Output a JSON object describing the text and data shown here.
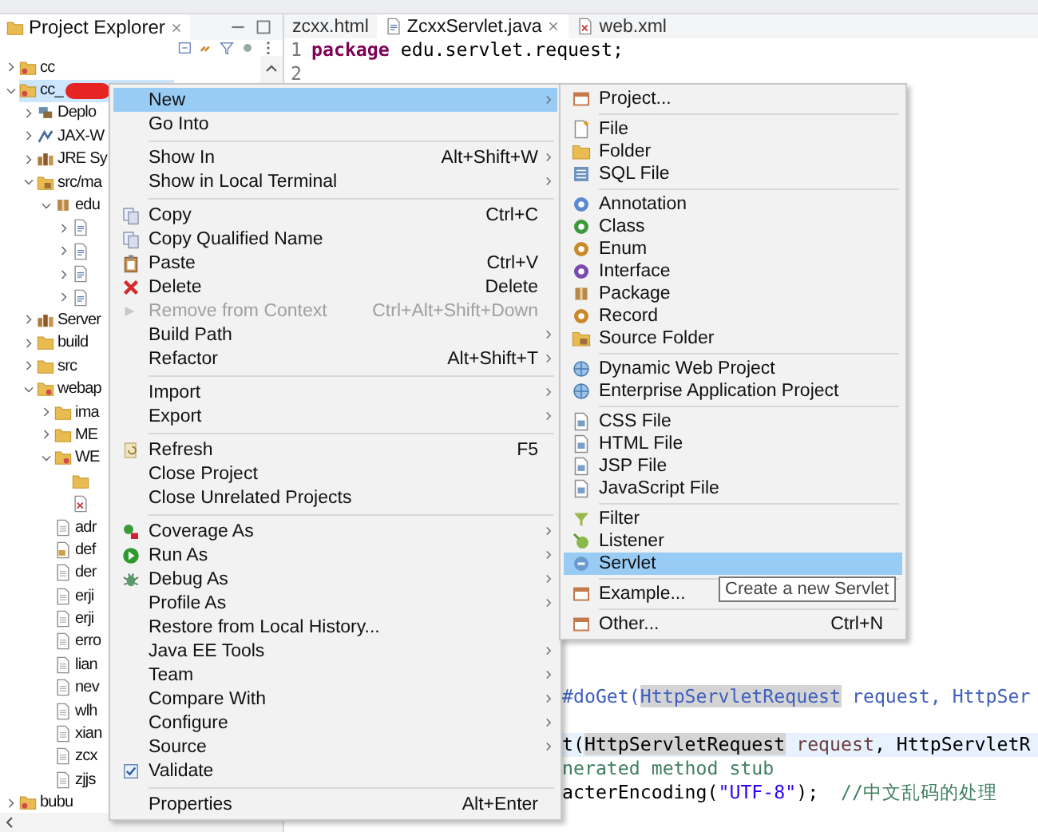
{
  "explorer": {
    "title": "Project Explorer",
    "tree": [
      {
        "label": "cc",
        "kind": "project",
        "expandable": true,
        "expanded": false,
        "selected": false
      },
      {
        "label": "cc_",
        "kind": "project",
        "expandable": true,
        "expanded": true,
        "selected": true,
        "redacted": true,
        "children": [
          {
            "label": "Deplo",
            "kind": "deploy",
            "expandable": true,
            "expanded": false,
            "selected": false
          },
          {
            "label": "JAX-W",
            "kind": "service",
            "expandable": true,
            "expanded": false,
            "selected": false
          },
          {
            "label": "JRE Sy",
            "kind": "library",
            "expandable": true,
            "expanded": false,
            "selected": false
          },
          {
            "label": "src/ma",
            "kind": "src_folder",
            "expandable": true,
            "expanded": true,
            "selected": false,
            "children": [
              {
                "label": "edu",
                "kind": "package",
                "expandable": true,
                "expanded": true,
                "selected": false,
                "children": [
                  {
                    "kind": "java",
                    "expandable": true,
                    "expanded": false,
                    "selected": false
                  },
                  {
                    "kind": "java",
                    "expandable": true,
                    "expanded": false,
                    "selected": false
                  },
                  {
                    "kind": "java",
                    "expandable": true,
                    "expanded": false,
                    "selected": false
                  },
                  {
                    "kind": "java",
                    "expandable": true,
                    "expanded": false,
                    "selected": false
                  }
                ]
              }
            ]
          },
          {
            "label": "Server",
            "kind": "library",
            "expandable": true,
            "expanded": false,
            "selected": false
          },
          {
            "label": "build",
            "kind": "folder",
            "expandable": true,
            "expanded": false,
            "selected": false
          },
          {
            "label": "src",
            "kind": "folder",
            "expandable": true,
            "expanded": false,
            "selected": false
          },
          {
            "label": "webap",
            "kind": "web_folder",
            "expandable": true,
            "expanded": true,
            "selected": false,
            "children": [
              {
                "label": "ima",
                "kind": "folder",
                "expandable": true,
                "expanded": false,
                "selected": false
              },
              {
                "label": "ME",
                "kind": "folder",
                "expandable": true,
                "expanded": false,
                "selected": false
              },
              {
                "label": "WE",
                "kind": "web_folder",
                "expandable": true,
                "expanded": true,
                "selected": false,
                "children": [
                  {
                    "kind": "folder",
                    "expandable": false,
                    "expanded": false,
                    "selected": false
                  },
                  {
                    "kind": "xml",
                    "expandable": false,
                    "expanded": false,
                    "selected": false
                  }
                ]
              },
              {
                "label": "adr",
                "kind": "file",
                "expandable": false,
                "expanded": false,
                "selected": false
              },
              {
                "label": "def",
                "kind": "jsp",
                "expandable": false,
                "expanded": false,
                "selected": false
              },
              {
                "label": "der",
                "kind": "file",
                "expandable": false,
                "expanded": false,
                "selected": false
              },
              {
                "label": "erji",
                "kind": "file",
                "expandable": false,
                "expanded": false,
                "selected": false
              },
              {
                "label": "erji",
                "kind": "file",
                "expandable": false,
                "expanded": false,
                "selected": false
              },
              {
                "label": "erro",
                "kind": "file",
                "expandable": false,
                "expanded": false,
                "selected": false
              },
              {
                "label": "lian",
                "kind": "file",
                "expandable": false,
                "expanded": false,
                "selected": false
              },
              {
                "label": "nev",
                "kind": "file",
                "expandable": false,
                "expanded": false,
                "selected": false
              },
              {
                "label": "wlh",
                "kind": "file",
                "expandable": false,
                "expanded": false,
                "selected": false
              },
              {
                "label": "xian",
                "kind": "file",
                "expandable": false,
                "expanded": false,
                "selected": false
              },
              {
                "label": "zcx",
                "kind": "file",
                "expandable": false,
                "expanded": false,
                "selected": false
              },
              {
                "label": "zjjs",
                "kind": "file",
                "expandable": false,
                "expanded": false,
                "selected": false
              }
            ]
          }
        ]
      },
      {
        "label": "bubu",
        "kind": "project",
        "expandable": true,
        "expanded": false,
        "selected": false
      }
    ]
  },
  "editor": {
    "tabs": [
      {
        "label": "zcxx.html",
        "kind": "plain",
        "selected": false
      },
      {
        "label": "ZcxxServlet.java",
        "kind": "java",
        "selected": true
      },
      {
        "label": "web.xml",
        "kind": "xml",
        "selected": false
      }
    ],
    "lines": [
      {
        "number": "1",
        "segments": [
          {
            "kind": "keyword",
            "text": "package"
          },
          {
            "kind": "plain",
            "text": " edu.servlet.request;"
          }
        ]
      },
      {
        "number": "2"
      }
    ],
    "covered_lines": [
      {
        "kind": "javadoc",
        "current": false,
        "segments": [
          {
            "kind": "javadoc",
            "text": "#doGet("
          },
          {
            "kind": "highlight",
            "text": "HttpServletRequest"
          },
          {
            "kind": "javadoc",
            "text": " request, HttpSer"
          }
        ]
      },
      {
        "kind": "code",
        "current": true,
        "segments": [
          {
            "kind": "plain",
            "text": "t("
          },
          {
            "kind": "highlight",
            "text": "HttpServletRequest"
          },
          {
            "kind": "param",
            "text": " request"
          },
          {
            "kind": "plain",
            "text": ", HttpServletR"
          }
        ]
      },
      {
        "kind": "code",
        "current": false,
        "segments": [
          {
            "kind": "comment",
            "text": "nerated method stub"
          }
        ]
      },
      {
        "kind": "code",
        "current": false,
        "segments": [
          {
            "kind": "plain",
            "text": "acterEncoding("
          },
          {
            "kind": "string",
            "text": "\"UTF-8\""
          },
          {
            "kind": "plain",
            "text": ");  "
          },
          {
            "kind": "comment",
            "text": "//中文乱码的处理"
          }
        ]
      }
    ]
  },
  "context_menu": {
    "items": [
      {
        "kind": "plain",
        "label": "New",
        "selected": true,
        "disabled": false,
        "has_submenu": true
      },
      {
        "kind": "plain",
        "label": "Go Into",
        "selected": false,
        "disabled": false,
        "has_submenu": false
      },
      {
        "kind": "separator"
      },
      {
        "kind": "plain",
        "label": "Show In",
        "shortcut": "Alt+Shift+W",
        "selected": false,
        "disabled": false,
        "has_submenu": true
      },
      {
        "kind": "plain",
        "label": "Show in Local Terminal",
        "selected": false,
        "disabled": false,
        "has_submenu": true
      },
      {
        "kind": "separator"
      },
      {
        "kind": "copy",
        "label": "Copy",
        "shortcut": "Ctrl+C",
        "selected": false,
        "disabled": false,
        "has_submenu": false
      },
      {
        "kind": "copy",
        "label": "Copy Qualified Name",
        "selected": false,
        "disabled": false,
        "has_submenu": false
      },
      {
        "kind": "paste",
        "label": "Paste",
        "shortcut": "Ctrl+V",
        "selected": false,
        "disabled": false,
        "has_submenu": false
      },
      {
        "kind": "delete",
        "label": "Delete",
        "shortcut": "Delete",
        "selected": false,
        "disabled": false,
        "has_submenu": false
      },
      {
        "kind": "remove",
        "label": "Remove from Context",
        "shortcut": "Ctrl+Alt+Shift+Down",
        "selected": false,
        "disabled": true,
        "has_submenu": false
      },
      {
        "kind": "plain",
        "label": "Build Path",
        "selected": false,
        "disabled": false,
        "has_submenu": true
      },
      {
        "kind": "plain",
        "label": "Refactor",
        "shortcut": "Alt+Shift+T",
        "selected": false,
        "disabled": false,
        "has_submenu": true
      },
      {
        "kind": "separator"
      },
      {
        "kind": "plain",
        "label": "Import",
        "selected": false,
        "disabled": false,
        "has_submenu": true
      },
      {
        "kind": "plain",
        "label": "Export",
        "selected": false,
        "disabled": false,
        "has_submenu": true
      },
      {
        "kind": "separator"
      },
      {
        "kind": "refresh",
        "label": "Refresh",
        "shortcut": "F5",
        "selected": false,
        "disabled": false,
        "has_submenu": false
      },
      {
        "kind": "plain",
        "label": "Close Project",
        "selected": false,
        "disabled": false,
        "has_submenu": false
      },
      {
        "kind": "plain",
        "label": "Close Unrelated Projects",
        "selected": false,
        "disabled": false,
        "has_submenu": false
      },
      {
        "kind": "separator"
      },
      {
        "kind": "coverage",
        "label": "Coverage As",
        "selected": false,
        "disabled": false,
        "has_submenu": true
      },
      {
        "kind": "run",
        "label": "Run As",
        "selected": false,
        "disabled": false,
        "has_submenu": true
      },
      {
        "kind": "debug",
        "label": "Debug As",
        "selected": false,
        "disabled": false,
        "has_submenu": true
      },
      {
        "kind": "plain",
        "label": "Profile As",
        "selected": false,
        "disabled": false,
        "has_submenu": true
      },
      {
        "kind": "plain",
        "label": "Restore from Local History...",
        "selected": false,
        "disabled": false,
        "has_submenu": false
      },
      {
        "kind": "plain",
        "label": "Java EE Tools",
        "selected": false,
        "disabled": false,
        "has_submenu": true
      },
      {
        "kind": "plain",
        "label": "Team",
        "selected": false,
        "disabled": false,
        "has_submenu": true
      },
      {
        "kind": "plain",
        "label": "Compare With",
        "selected": false,
        "disabled": false,
        "has_submenu": true
      },
      {
        "kind": "plain",
        "label": "Configure",
        "selected": false,
        "disabled": false,
        "has_submenu": true
      },
      {
        "kind": "plain",
        "label": "Source",
        "selected": false,
        "disabled": false,
        "has_submenu": true
      },
      {
        "kind": "check",
        "label": "Validate",
        "checked": true,
        "selected": false,
        "disabled": false,
        "has_submenu": false
      },
      {
        "kind": "separator"
      },
      {
        "kind": "plain",
        "label": "Properties",
        "shortcut": "Alt+Enter",
        "selected": false,
        "disabled": false,
        "has_submenu": false
      }
    ]
  },
  "submenu": {
    "items": [
      {
        "kind": "window",
        "label": "Project...",
        "selected": false
      },
      {
        "kind": "separator"
      },
      {
        "kind": "newfile",
        "label": "File",
        "selected": false
      },
      {
        "kind": "folder",
        "label": "Folder",
        "selected": false
      },
      {
        "kind": "sql",
        "label": "SQL File",
        "selected": false
      },
      {
        "kind": "separator"
      },
      {
        "kind": "annotation",
        "label": "Annotation",
        "selected": false
      },
      {
        "kind": "class",
        "label": "Class",
        "selected": false
      },
      {
        "kind": "enum",
        "label": "Enum",
        "selected": false
      },
      {
        "kind": "interface",
        "label": "Interface",
        "selected": false
      },
      {
        "kind": "package",
        "label": "Package",
        "selected": false
      },
      {
        "kind": "record",
        "label": "Record",
        "selected": false
      },
      {
        "kind": "src_folder",
        "label": "Source Folder",
        "selected": false
      },
      {
        "kind": "separator"
      },
      {
        "kind": "globe",
        "label": "Dynamic Web Project",
        "selected": false
      },
      {
        "kind": "globe",
        "label": "Enterprise Application Project",
        "selected": false
      },
      {
        "kind": "separator"
      },
      {
        "kind": "webfile",
        "label": "CSS File",
        "selected": false
      },
      {
        "kind": "webfile",
        "label": "HTML File",
        "selected": false
      },
      {
        "kind": "webfile",
        "label": "JSP File",
        "selected": false
      },
      {
        "kind": "webfile",
        "label": "JavaScript File",
        "selected": false
      },
      {
        "kind": "separator"
      },
      {
        "kind": "filter",
        "label": "Filter",
        "selected": false
      },
      {
        "kind": "listener",
        "label": "Listener",
        "selected": false
      },
      {
        "kind": "servlet",
        "label": "Servlet",
        "selected": true
      },
      {
        "kind": "separator"
      },
      {
        "kind": "window",
        "label": "Example...",
        "selected": false
      },
      {
        "kind": "separator"
      },
      {
        "kind": "window",
        "label": "Other...",
        "shortcut": "Ctrl+N",
        "selected": false
      }
    ]
  },
  "tooltip": {
    "text": "Create a new Servlet"
  }
}
